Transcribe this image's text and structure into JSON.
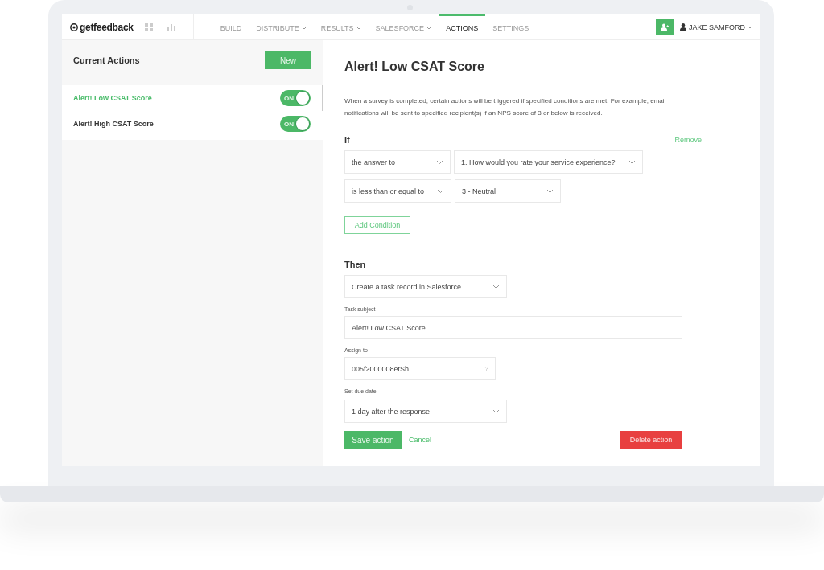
{
  "nav": {
    "logo": "getfeedback",
    "items": [
      {
        "label": "BUILD",
        "dropdown": false,
        "selected": false
      },
      {
        "label": "DISTRIBUTE",
        "dropdown": true,
        "selected": false
      },
      {
        "label": "RESULTS",
        "dropdown": true,
        "selected": false
      },
      {
        "label": "SALESFORCE",
        "dropdown": true,
        "selected": false
      },
      {
        "label": "ACTIONS",
        "dropdown": false,
        "selected": true
      },
      {
        "label": "SETTINGS",
        "dropdown": false,
        "selected": false
      }
    ],
    "user": "JAKE SAMFORD"
  },
  "sidebar": {
    "title": "Current Actions",
    "new_button": "New",
    "items": [
      {
        "label": "Alert! Low CSAT Score",
        "selected": true,
        "toggle": "ON",
        "on": true
      },
      {
        "label": "Alert! High CSAT Score",
        "selected": false,
        "toggle": "ON",
        "on": true
      }
    ]
  },
  "detail": {
    "title": "Alert! Low CSAT Score",
    "description": "When a survey is completed, certain actions will be triggered if specified conditions are met. For example, email notifications will be sent to specified recipient(s) if an NPS score of 3 or below is received.",
    "if_heading": "If",
    "remove": "Remove",
    "conditions": [
      [
        "the answer to",
        "1. How would you rate your service experience?"
      ],
      [
        "is less than or equal to",
        "3 - Neutral"
      ]
    ],
    "add_condition": "Add Condition",
    "then_heading": "Then",
    "fields": [
      {
        "kind": "select",
        "value": "Create a task record in Salesforce"
      },
      {
        "kind": "text",
        "label": "Task subject",
        "value": "Alert! Low CSAT Score"
      },
      {
        "kind": "lookup",
        "label": "Assign to",
        "value": "005f2000008etSh",
        "help": "?"
      },
      {
        "kind": "select",
        "label": "Set due date",
        "value": "1 day after the response"
      }
    ],
    "save": "Save action",
    "cancel": "Cancel",
    "delete": "Delete action"
  }
}
